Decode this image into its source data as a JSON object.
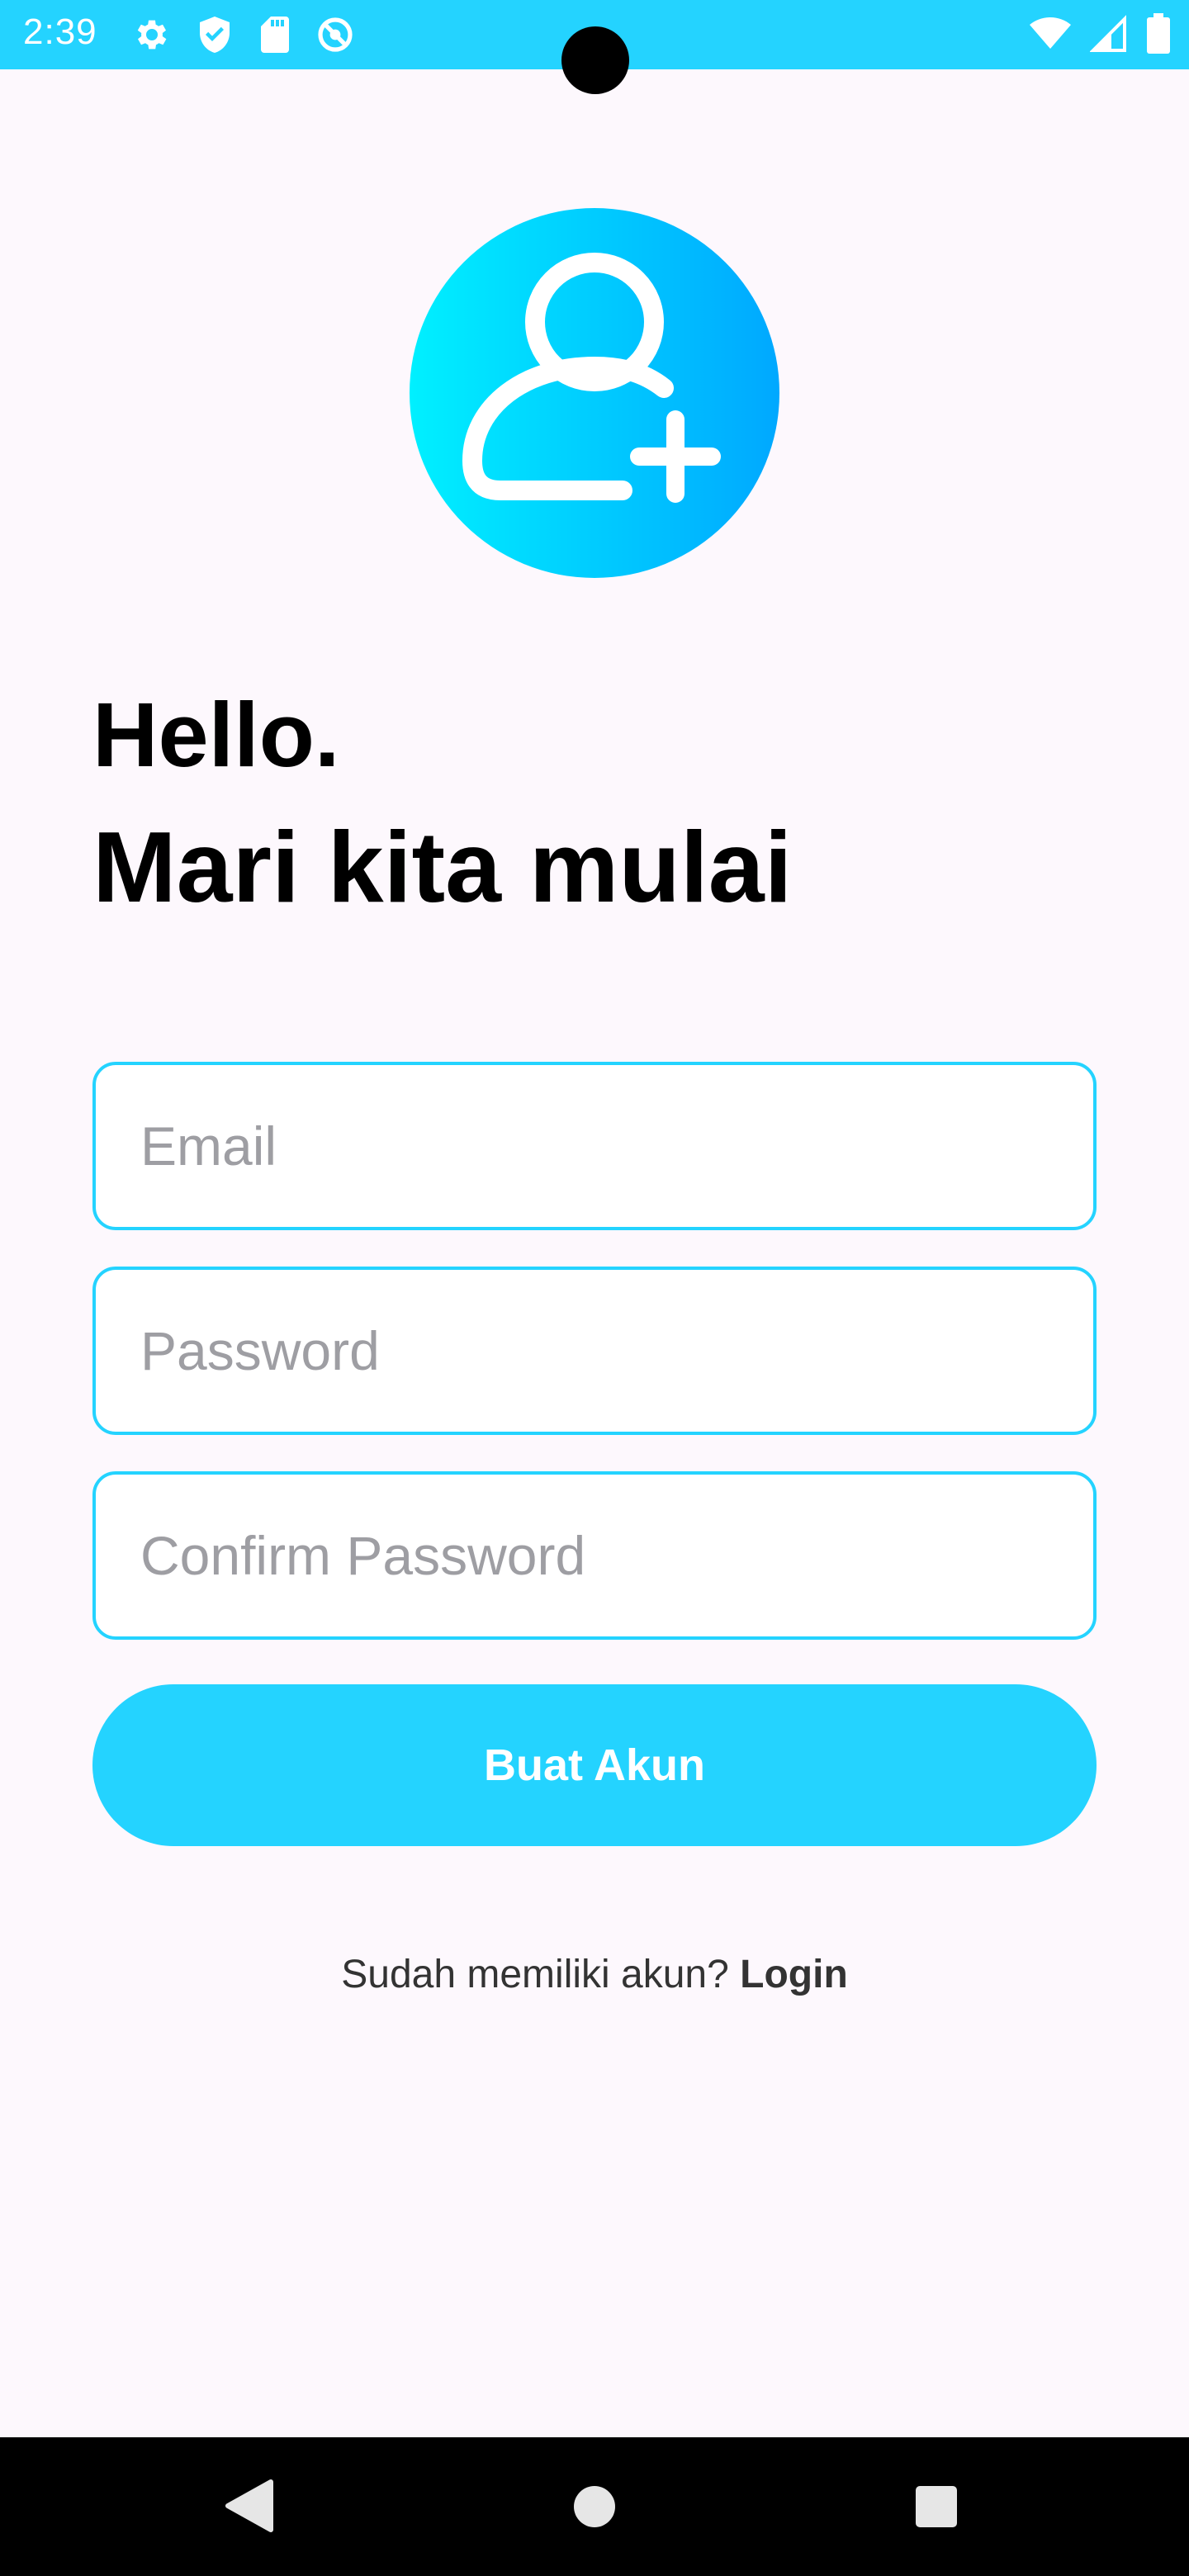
{
  "status_bar": {
    "time": "2:39",
    "color": "#24d3ff",
    "left_icons": [
      "gear-icon",
      "shield-icon",
      "sd-card-icon",
      "no-disturb-icon"
    ],
    "right_icons": [
      "wifi-icon",
      "signal-icon",
      "battery-icon"
    ]
  },
  "avatar": {
    "icon": "add-user-icon",
    "gradient_start": "#00f0ff",
    "gradient_end": "#00a8ff"
  },
  "header": {
    "greeting": "Hello.",
    "subtitle": "Mari kita mulai"
  },
  "form": {
    "email": {
      "value": "",
      "placeholder": "Email"
    },
    "password": {
      "value": "",
      "placeholder": "Password"
    },
    "confirm_password": {
      "value": "",
      "placeholder": "Confirm Password"
    },
    "submit_label": "Buat Akun",
    "accent_color": "#24d3ff"
  },
  "footer": {
    "prompt": "Sudah memiliki akun? ",
    "login_label": "Login"
  },
  "nav_bar": {
    "icons": [
      "back-icon",
      "home-icon",
      "recents-icon"
    ]
  }
}
